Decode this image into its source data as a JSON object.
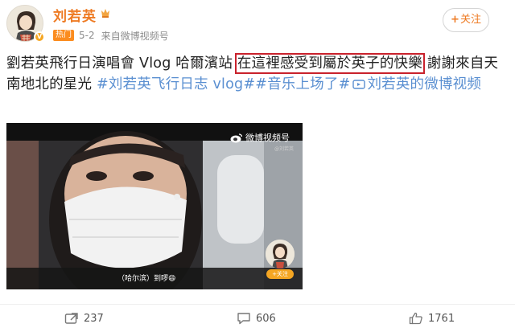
{
  "author": {
    "name": "刘若英",
    "member_icon": "vip-crown-icon",
    "verified_icon": "verified-badge-icon"
  },
  "meta": {
    "hot_badge": "热门",
    "date": "5-2",
    "source": "来自微博视频号"
  },
  "follow_button": {
    "plus": "+",
    "label": "关注"
  },
  "post": {
    "text_before": "劉若英飛行日演唱會 Vlog 哈爾濱站 ",
    "highlighted_text": "在這裡感受到屬於英子的快樂",
    "text_after": " 謝謝來自天南地北的星光 ",
    "tags": [
      "#刘若英飞行日志 vlog#",
      "#音乐上场了#"
    ],
    "link_icon": "video-link-icon",
    "link_text": "刘若英的微博视频"
  },
  "video": {
    "watermark": "微博视频号",
    "watermark_sub": "@刘若英",
    "subtitle": "（哈尔滨）到啰😄",
    "mini_follow": "+关注"
  },
  "actions": {
    "repost": {
      "icon": "repost-icon",
      "count": "237"
    },
    "comment": {
      "icon": "comment-icon",
      "count": "606"
    },
    "like": {
      "icon": "thumbs-up-icon",
      "count": "1761"
    }
  },
  "colors": {
    "accent": "#ee7a22",
    "link": "#5a8fd1",
    "highlight_border": "#c9222c"
  }
}
